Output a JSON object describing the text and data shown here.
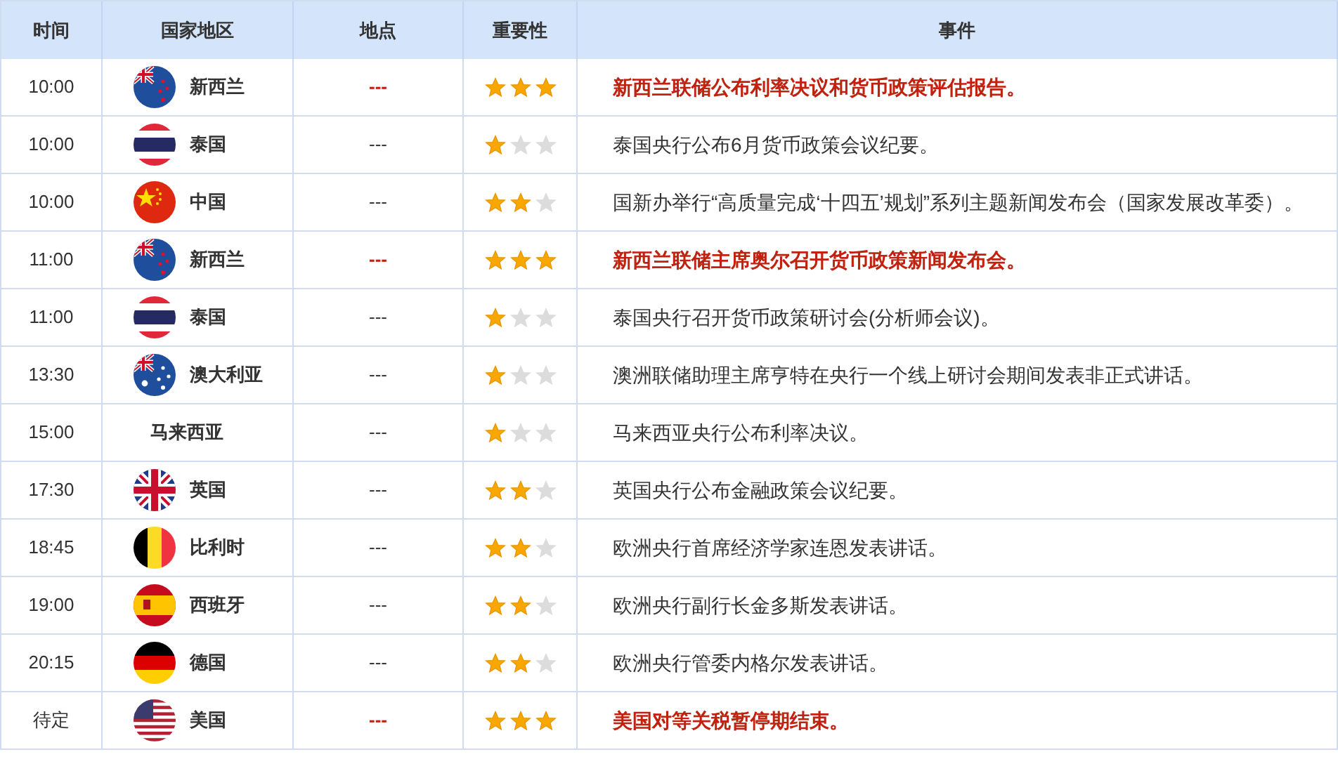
{
  "table": {
    "columns": [
      "时间",
      "国家地区",
      "地点",
      "重要性",
      "事件"
    ],
    "rows": [
      {
        "time": "10:00",
        "flag": {
          "kind": "nz"
        },
        "country": "新西兰",
        "location": "---",
        "stars": 3,
        "important": true,
        "event": "新西兰联储公布利率决议和货币政策评估报告。"
      },
      {
        "time": "10:00",
        "flag": {
          "kind": "th"
        },
        "country": "泰国",
        "location": "---",
        "stars": 1,
        "important": false,
        "event": "泰国央行公布6月货币政策会议纪要。"
      },
      {
        "time": "10:00",
        "flag": {
          "kind": "cn"
        },
        "country": "中国",
        "location": "---",
        "stars": 2,
        "important": false,
        "event": "国新办举行“高质量完成‘十四五’规划”系列主题新闻发布会（国家发展改革委）。"
      },
      {
        "time": "11:00",
        "flag": {
          "kind": "nz"
        },
        "country": "新西兰",
        "location": "---",
        "stars": 3,
        "important": true,
        "event": "新西兰联储主席奥尔召开货币政策新闻发布会。"
      },
      {
        "time": "11:00",
        "flag": {
          "kind": "th"
        },
        "country": "泰国",
        "location": "---",
        "stars": 1,
        "important": false,
        "event": "泰国央行召开货币政策研讨会(分析师会议)。"
      },
      {
        "time": "13:30",
        "flag": {
          "kind": "au"
        },
        "country": "澳大利亚",
        "location": "---",
        "stars": 1,
        "important": false,
        "event": "澳洲联储助理主席亨特在央行一个线上研讨会期间发表非正式讲话。"
      },
      {
        "time": "15:00",
        "country": "马来西亚",
        "location": "---",
        "stars": 1,
        "important": false,
        "event": "马来西亚央行公布利率决议。"
      },
      {
        "time": "17:30",
        "flag": {
          "kind": "gb"
        },
        "country": "英国",
        "location": "---",
        "stars": 2,
        "important": false,
        "event": "英国央行公布金融政策会议纪要。"
      },
      {
        "time": "18:45",
        "flag": {
          "kind": "be"
        },
        "country": "比利时",
        "location": "---",
        "stars": 2,
        "important": false,
        "event": "欧洲央行首席经济学家连恩发表讲话。"
      },
      {
        "time": "19:00",
        "flag": {
          "kind": "es"
        },
        "country": "西班牙",
        "location": "---",
        "stars": 2,
        "important": false,
        "event": "欧洲央行副行长金多斯发表讲话。"
      },
      {
        "time": "20:15",
        "flag": {
          "kind": "de"
        },
        "country": "德国",
        "location": "---",
        "stars": 2,
        "important": false,
        "event": "欧洲央行管委内格尔发表讲话。"
      },
      {
        "time": "待定",
        "flag": {
          "kind": "us"
        },
        "country": "美国",
        "location": "---",
        "stars": 3,
        "important": true,
        "event": "美国对等关税暂停期结束。"
      }
    ]
  }
}
